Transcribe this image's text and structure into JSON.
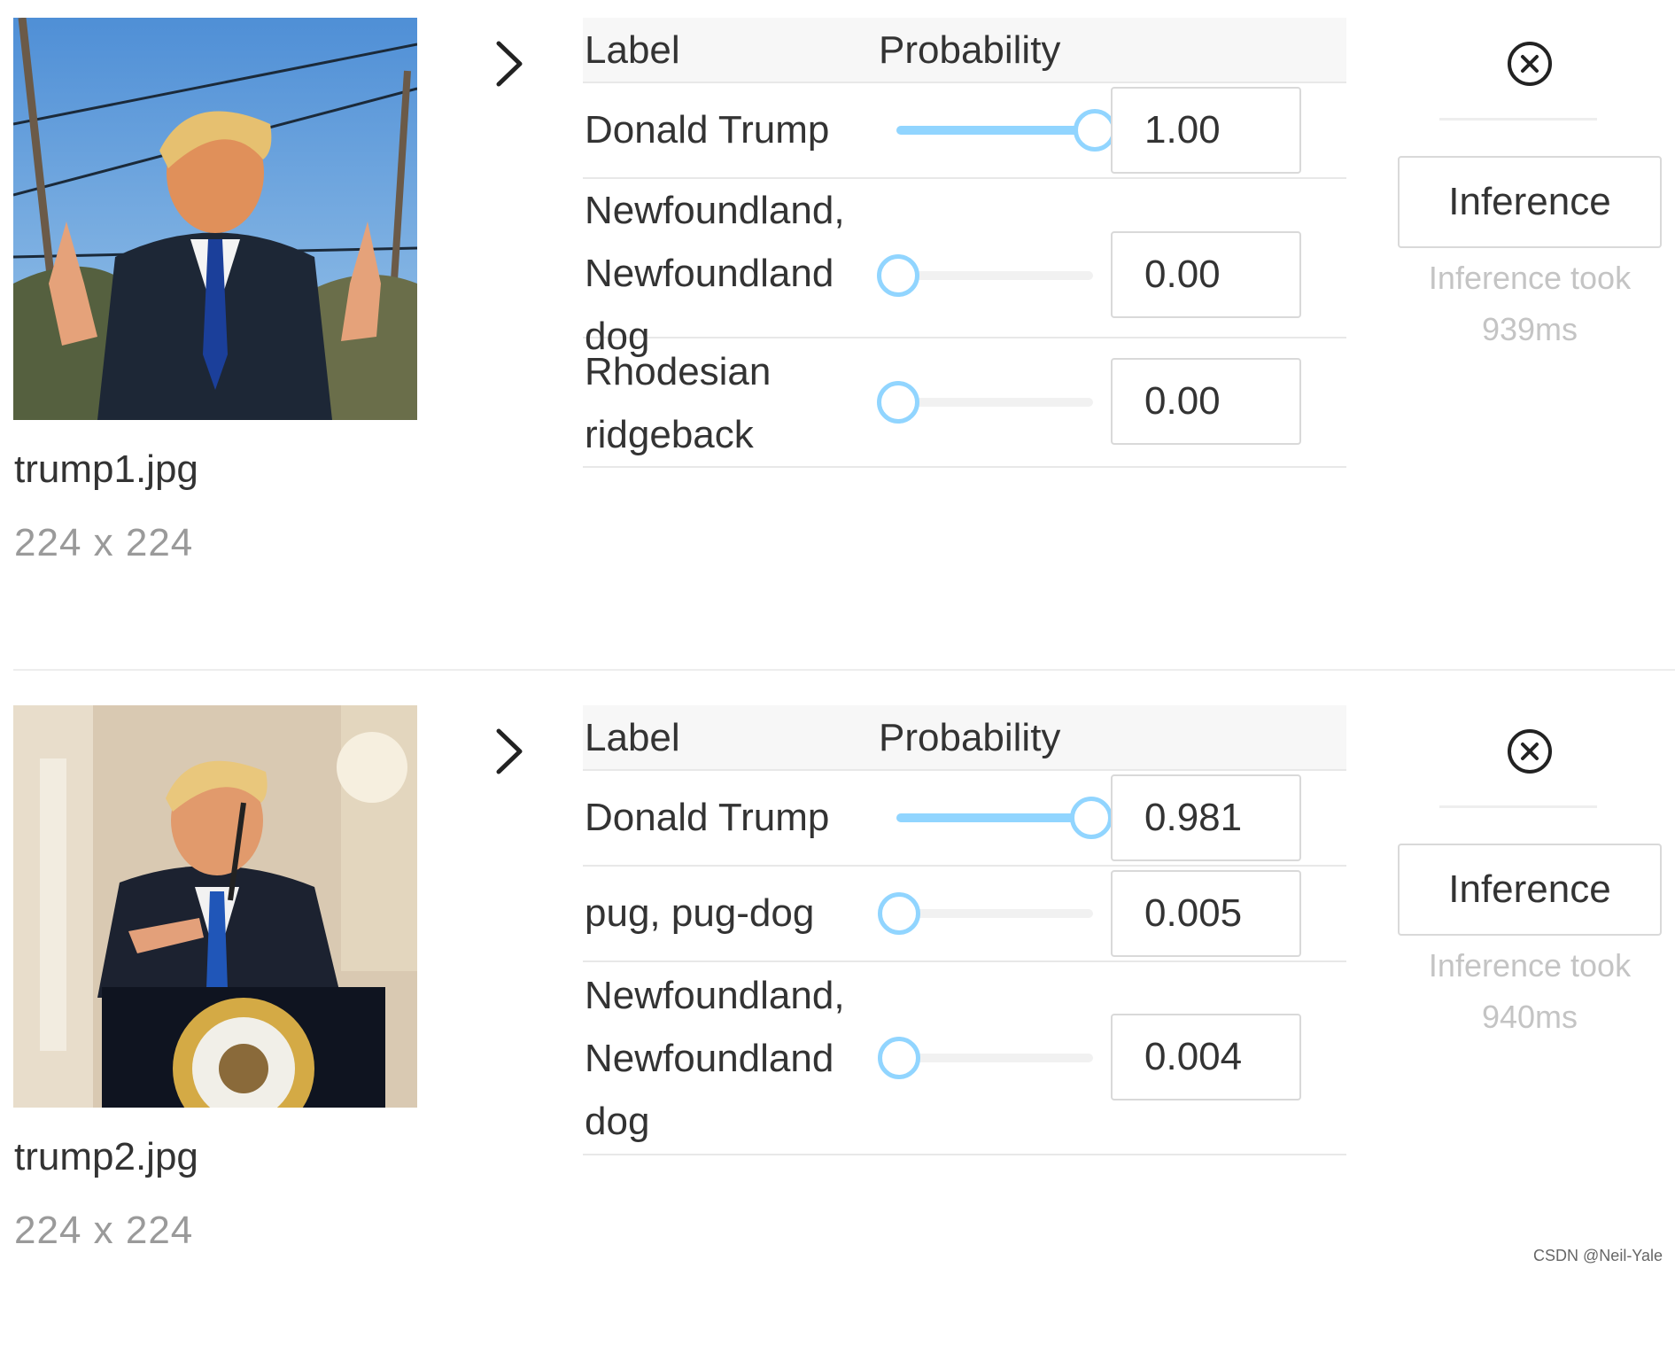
{
  "results": [
    {
      "file_name": "trump1.jpg",
      "dimensions": "224 x 224",
      "table_header": {
        "label": "Label",
        "probability": "Probability"
      },
      "rows": [
        {
          "label": "Donald Trump",
          "value": "1.00",
          "level": 1.0
        },
        {
          "label": "Newfoundland, Newfoundland dog",
          "value": "0.00",
          "level": 0.0
        },
        {
          "label": "Rhodesian ridgeback",
          "value": "0.00",
          "level": 0.0
        }
      ],
      "inference_button": "Inference",
      "inference_time": "Inference took 939ms"
    },
    {
      "file_name": "trump2.jpg",
      "dimensions": "224 x 224",
      "table_header": {
        "label": "Label",
        "probability": "Probability"
      },
      "rows": [
        {
          "label": "Donald Trump",
          "value": "0.981",
          "level": 0.981
        },
        {
          "label": "pug, pug-dog",
          "value": "0.005",
          "level": 0.005
        },
        {
          "label": "Newfoundland, Newfoundland dog",
          "value": "0.004",
          "level": 0.004
        }
      ],
      "inference_button": "Inference",
      "inference_time": "Inference took 940ms"
    }
  ],
  "watermark": "CSDN @Neil-Yale",
  "icons": {
    "expand": "chevron-right-icon",
    "close": "close-circle-icon"
  },
  "colors": {
    "slider": "#91d5ff",
    "track": "#f1f1f1",
    "muted_text": "#c4c4c4"
  }
}
